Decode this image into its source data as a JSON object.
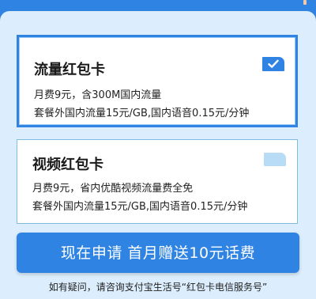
{
  "colors": {
    "accent": "#2f84e3",
    "background": "#dceefd",
    "card_border_plain": "#7fbde0",
    "badge_inactive": "#b8dcf6"
  },
  "cards": [
    {
      "title": "流量红包卡",
      "line1": "月费9元，含300M国内流量",
      "line2": "套餐外国内流量15元/GB,国内语音0.15元/分钟",
      "selected": true,
      "badge_icon": "check-icon"
    },
    {
      "title": "视频红包卡",
      "line1": "月费9元，省内优酷视频流量费全免",
      "line2": "套餐外国内流量15元/GB,国内语音0.15元/分钟",
      "selected": false,
      "badge_icon": "unselected-badge-icon"
    }
  ],
  "apply_button": {
    "label": "现在申请  首月赠送10元话费"
  },
  "help_text": "如有疑问，请咨询支付宝生活号“红包卡电信服务号”"
}
